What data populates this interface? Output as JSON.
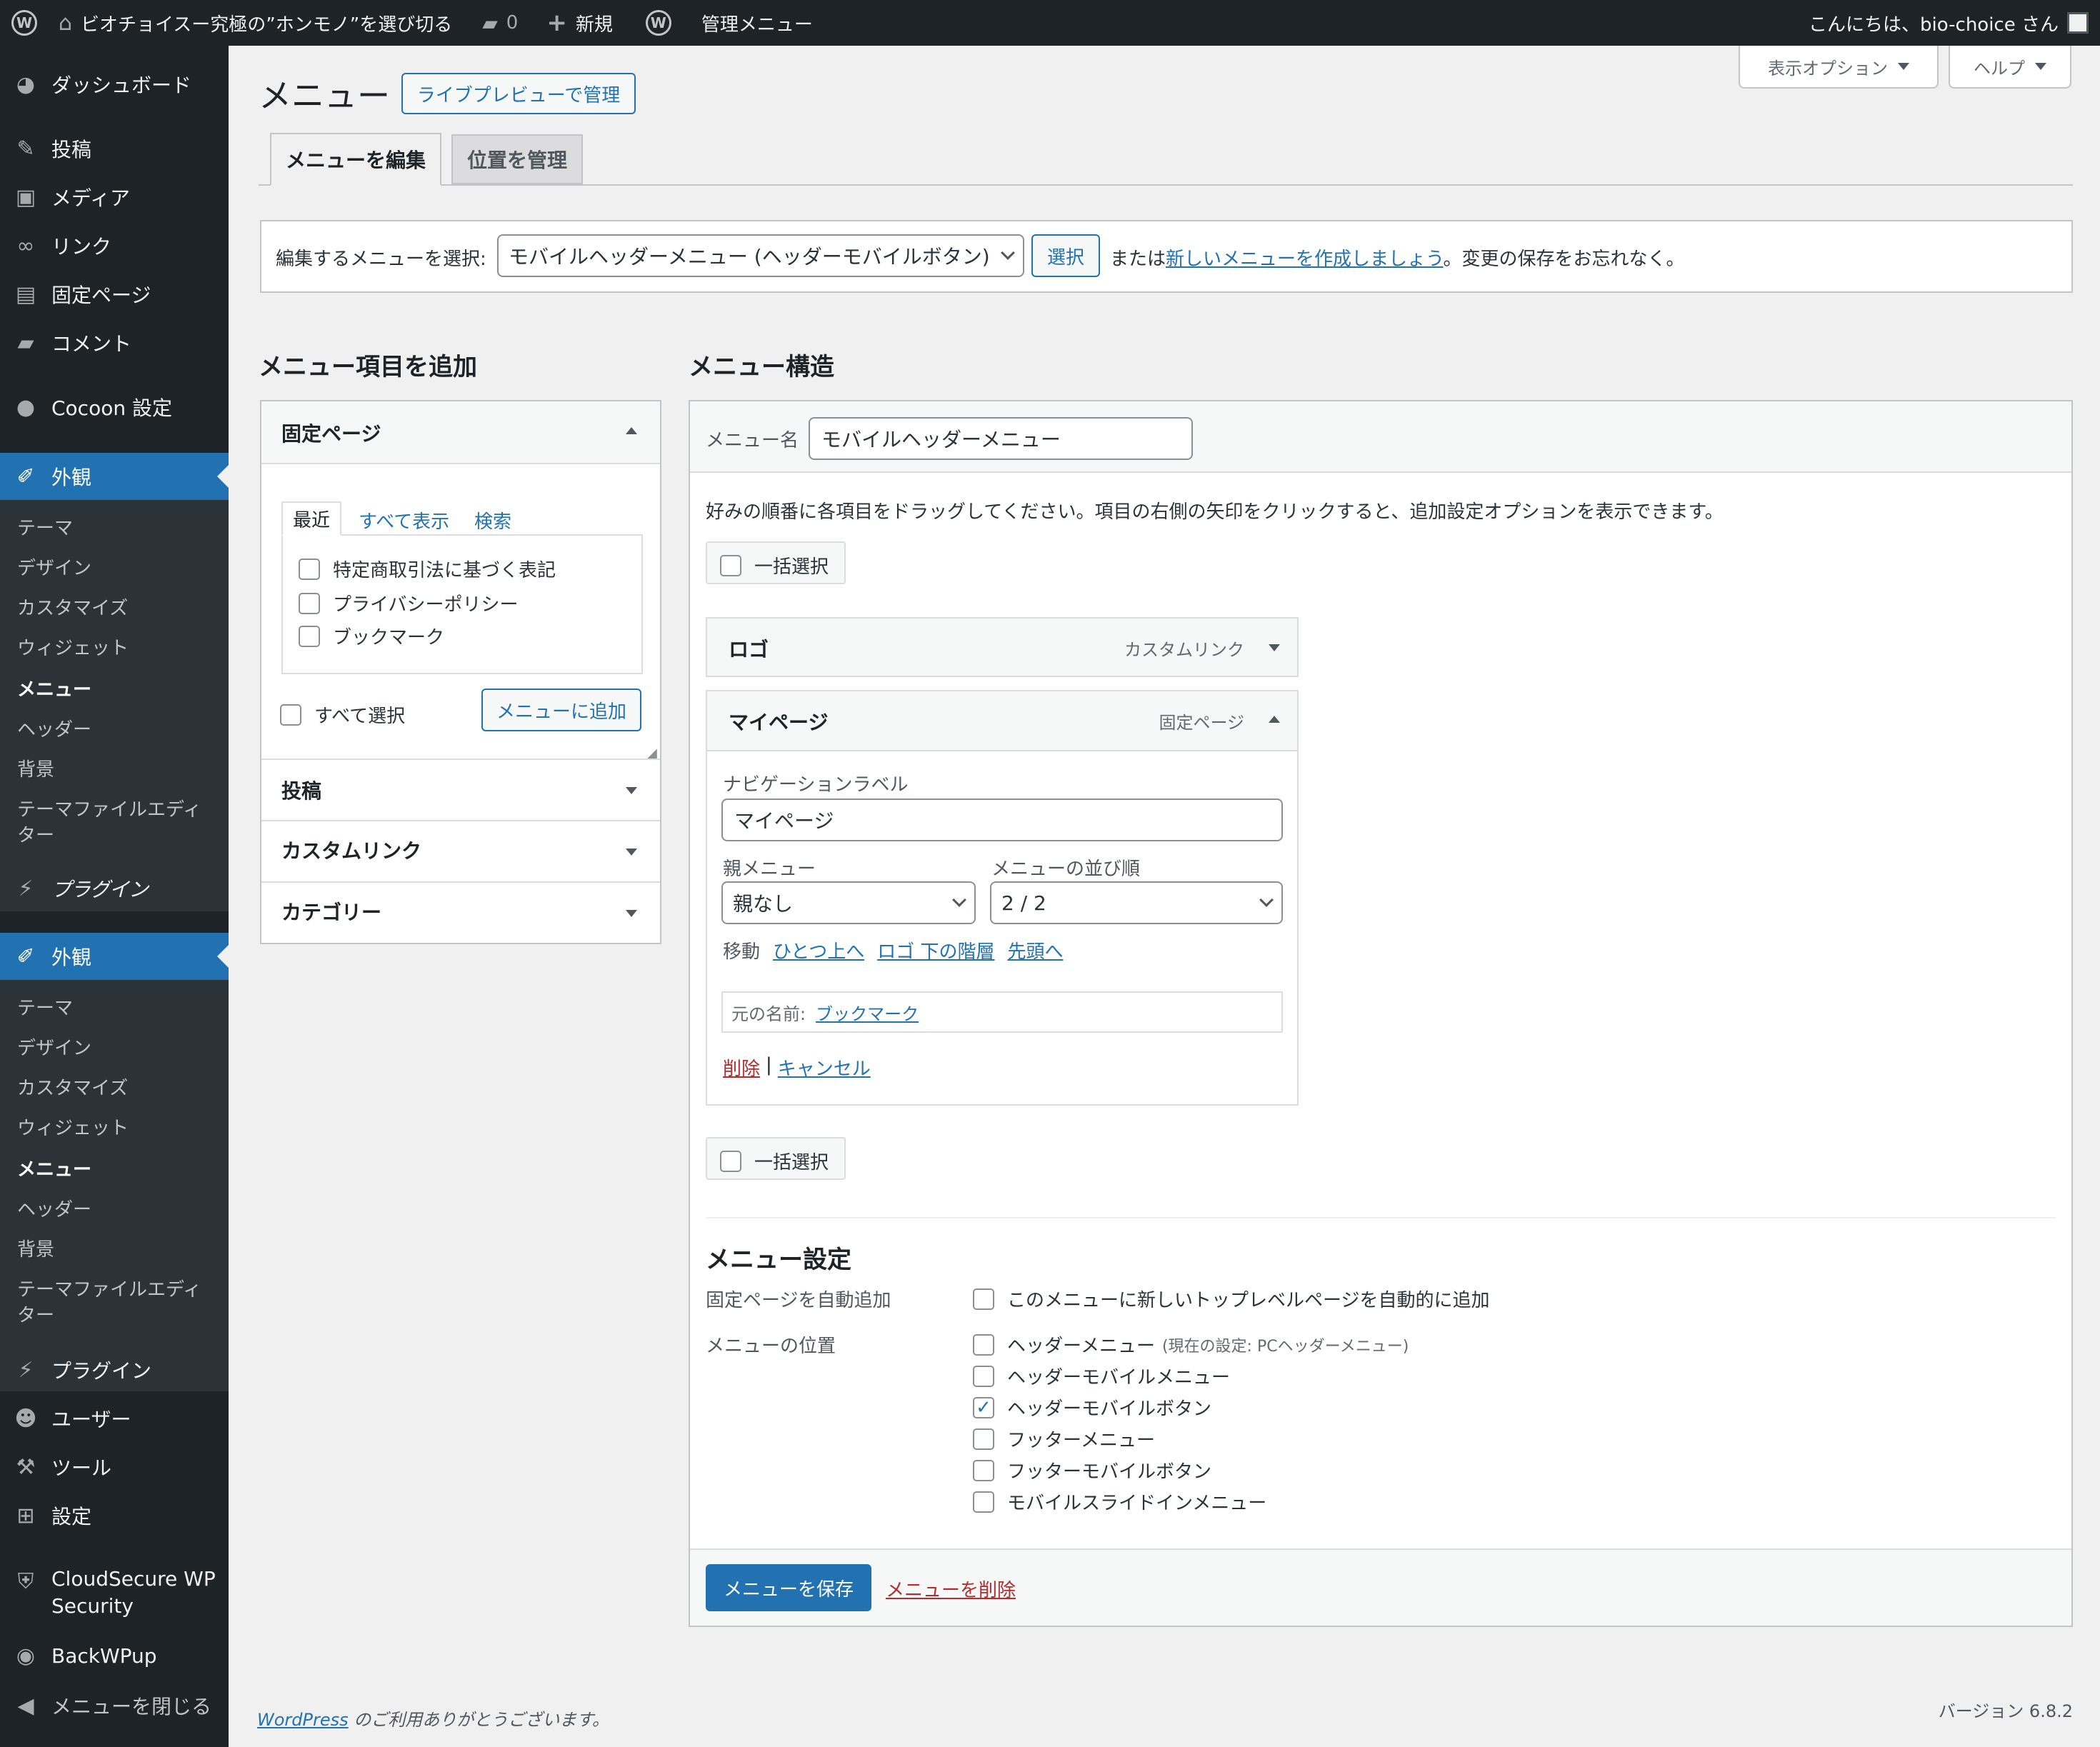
{
  "adminbar": {
    "site_name": "ビオチョイスー究極の”ホンモノ”を選び切る",
    "comments_count": "0",
    "new_label": "新規",
    "admin_menu_label": "管理メニュー",
    "greeting": "こんにちは、bio-choice さん"
  },
  "sidebar": {
    "dashboard": "ダッシュボード",
    "posts": "投稿",
    "media": "メディア",
    "links": "リンク",
    "pages": "固定ページ",
    "comments": "コメント",
    "cocoon": "Cocoon 設定",
    "appearance": "外観",
    "appearance_sub": [
      "テーマ",
      "デザイン",
      "カスタマイズ",
      "ウィジェット",
      "メニュー",
      "ヘッダー",
      "背景",
      "テーマファイルエディ",
      "ター"
    ],
    "plugins_garbled": "プラグイン",
    "appearance2": "外観",
    "appearance2_sub": [
      "テーマ",
      "デザイン",
      "カスタマイズ",
      "ウィジェット",
      "メニュー",
      "ヘッダー",
      "背景",
      "テーマファイルエディ",
      "ター"
    ],
    "plugins": "プラグイン",
    "users": "ユーザー",
    "tools": "ツール",
    "settings": "設定",
    "cloudsecure_line1": "CloudSecure WP",
    "cloudsecure_line2": "Security",
    "backwpup": "BackWPup",
    "collapse": "メニューを閉じる"
  },
  "screen_options": "表示オプション",
  "help": "ヘルプ",
  "page_title": "メニュー",
  "live_preview_button": "ライブプレビューで管理",
  "tabs": {
    "edit": "メニューを編集",
    "locations": "位置を管理"
  },
  "select_bar": {
    "label": "編集するメニューを選択:",
    "selected": "モバイルヘッダーメニュー (ヘッダーモバイルボタン)",
    "select_button": "選択",
    "or_text": "または",
    "create_link": "新しいメニューを作成しましょう",
    "suffix": "。変更の保存をお忘れなく。"
  },
  "add_items": {
    "heading": "メニュー項目を追加",
    "pages_title": "固定ページ",
    "tabs": [
      "最近",
      "すべて表示",
      "検索"
    ],
    "pages": [
      "特定商取引法に基づく表記",
      "プライバシーポリシー",
      "ブックマーク"
    ],
    "select_all": "すべて選択",
    "add_button": "メニューに追加",
    "accordions": [
      "投稿",
      "カスタムリンク",
      "カテゴリー"
    ]
  },
  "structure": {
    "heading": "メニュー構造",
    "name_label": "メニュー名",
    "name_value": "モバイルヘッダーメニュー",
    "instructions": "好みの順番に各項目をドラッグしてください。項目の右側の矢印をクリックすると、追加設定オプションを表示できます。",
    "bulk_select": "一括選択",
    "items": [
      {
        "title": "ロゴ",
        "type": "カスタムリンク"
      },
      {
        "title": "マイページ",
        "type": "固定ページ"
      }
    ],
    "nav_label_caption": "ナビゲーションラベル",
    "nav_label_value": "マイページ",
    "parent_caption": "親メニュー",
    "parent_value": "親なし",
    "order_caption": "メニューの並び順",
    "order_value": "2 / 2",
    "move_label": "移動",
    "move_links": [
      "ひとつ上へ",
      "ロゴ 下の階層",
      "先頭へ"
    ],
    "original_label": "元の名前:",
    "original_link": "ブックマーク",
    "delete_link": "削除",
    "separator": "|",
    "cancel_link": "キャンセル"
  },
  "settings": {
    "heading": "メニュー設定",
    "auto_add_label": "固定ページを自動追加",
    "auto_add_option": "このメニューに新しいトップレベルページを自動的に追加",
    "location_label": "メニューの位置",
    "locations": [
      {
        "name": "ヘッダーメニュー",
        "note": "(現在の設定: PCヘッダーメニュー)",
        "checked": false
      },
      {
        "name": "ヘッダーモバイルメニュー",
        "note": "",
        "checked": false
      },
      {
        "name": "ヘッダーモバイルボタン",
        "note": "",
        "checked": true
      },
      {
        "name": "フッターメニュー",
        "note": "",
        "checked": false
      },
      {
        "name": "フッターモバイルボタン",
        "note": "",
        "checked": false
      },
      {
        "name": "モバイルスライドインメニュー",
        "note": "",
        "checked": false
      }
    ],
    "checkmark": "✓"
  },
  "footer_actions": {
    "save": "メニューを保存",
    "delete": "メニューを削除"
  },
  "footer": {
    "wp_link": "WordPress",
    "thanks": " のご利用ありがとうございます。",
    "version": "バージョン 6.8.2"
  },
  "colors": {
    "primary": "#2271b1",
    "adminbar": "#1d2327",
    "danger": "#b32d2e",
    "background": "#f0f0f1"
  },
  "icons": [
    "wordpress-logo-icon",
    "home-icon",
    "comment-icon",
    "plus-icon",
    "dashboard-icon",
    "pushpin-icon",
    "media-icon",
    "link-icon",
    "page-icon",
    "comment-bubble-icon",
    "circle-icon",
    "paintbrush-icon",
    "plugin-icon",
    "user-icon",
    "wrench-icon",
    "settings-icon",
    "shield-icon",
    "backwpup-icon",
    "collapse-arrow-icon"
  ]
}
